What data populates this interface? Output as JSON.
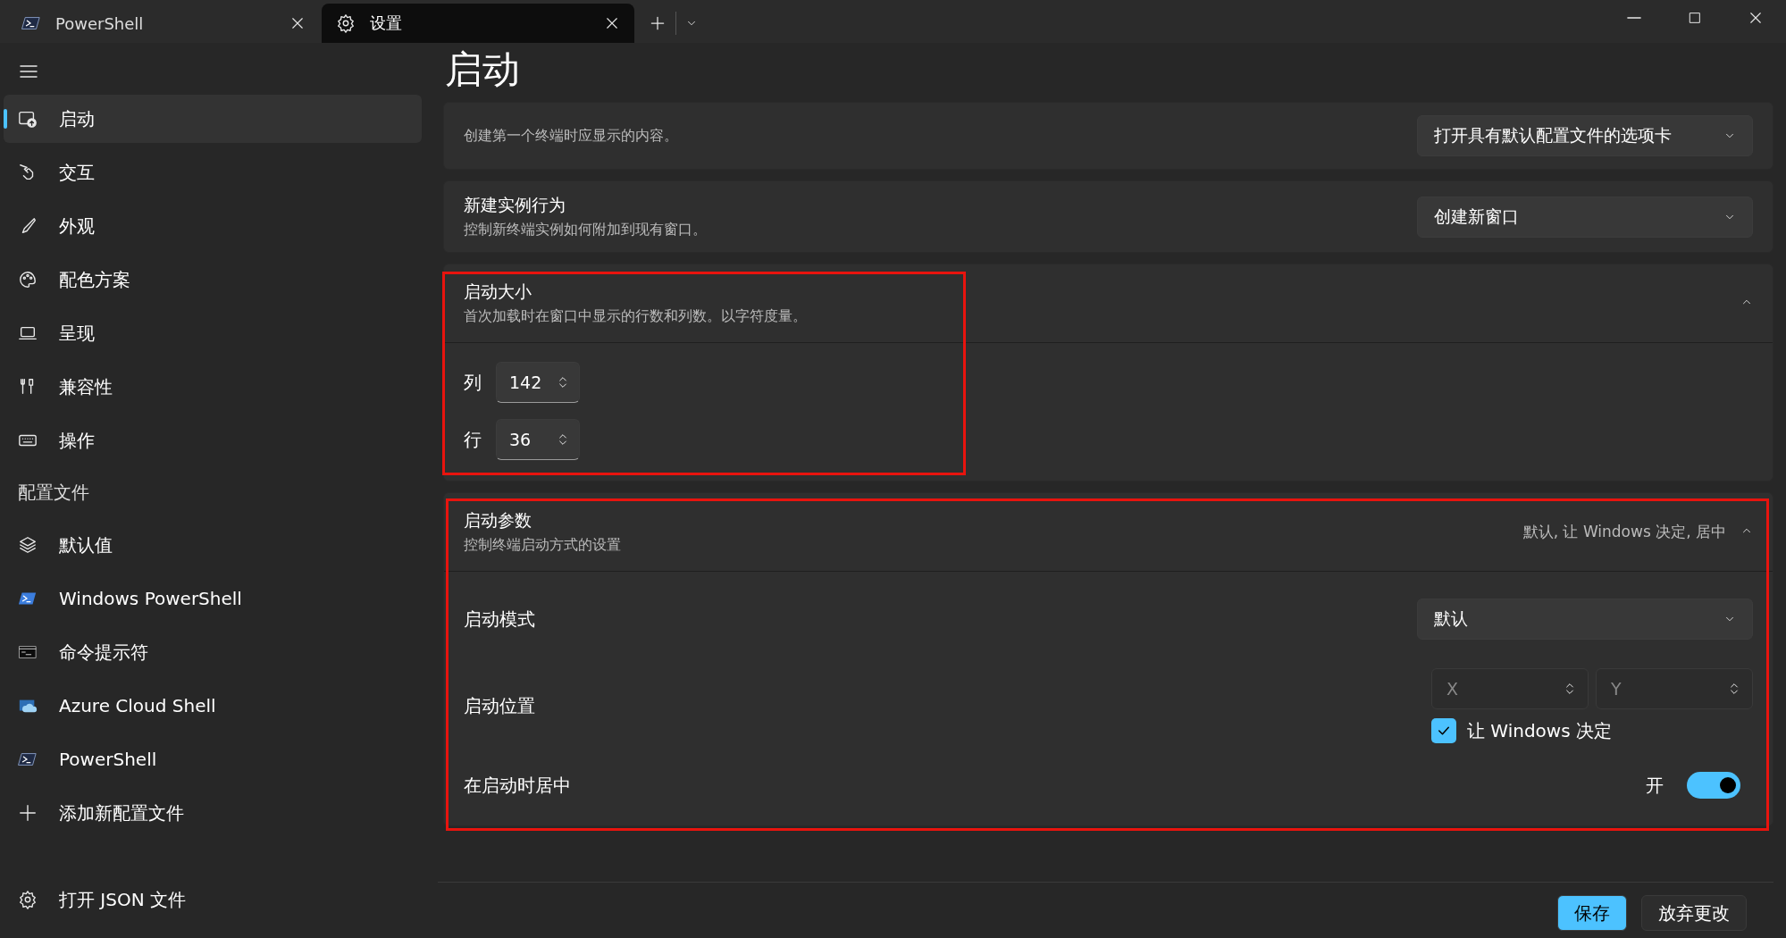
{
  "tabs": [
    {
      "label": "PowerShell",
      "selected": false
    },
    {
      "label": "设置",
      "selected": true
    }
  ],
  "sidebar": {
    "items": [
      {
        "kind": "nav",
        "label": "启动",
        "selected": true
      },
      {
        "kind": "nav",
        "label": "交互",
        "selected": false
      },
      {
        "kind": "nav",
        "label": "外观",
        "selected": false
      },
      {
        "kind": "nav",
        "label": "配色方案",
        "selected": false
      },
      {
        "kind": "nav",
        "label": "呈现",
        "selected": false
      },
      {
        "kind": "nav",
        "label": "兼容性",
        "selected": false
      },
      {
        "kind": "nav",
        "label": "操作",
        "selected": false
      },
      {
        "kind": "header",
        "label": "配置文件"
      },
      {
        "kind": "nav",
        "label": "默认值",
        "selected": false
      },
      {
        "kind": "nav",
        "label": "Windows PowerShell",
        "selected": false
      },
      {
        "kind": "nav",
        "label": "命令提示符",
        "selected": false
      },
      {
        "kind": "nav",
        "label": "Azure Cloud Shell",
        "selected": false
      },
      {
        "kind": "nav",
        "label": "PowerShell",
        "selected": false
      },
      {
        "kind": "nav",
        "label": "添加新配置文件",
        "selected": false
      }
    ],
    "footer_item": {
      "label": "打开 JSON 文件"
    }
  },
  "page": {
    "title": "启动",
    "cards": [
      {
        "kind": "dropdown",
        "description": "创建第一个终端时应显示的内容。",
        "value": "打开具有默认配置文件的选项卡"
      },
      {
        "kind": "dropdown",
        "title": "新建实例行为",
        "description": "控制新终端实例如何附加到现有窗口。",
        "value": "创建新窗口"
      },
      {
        "kind": "expander",
        "title": "启动大小",
        "description": "首次加载时在窗口中显示的行数和列数。以字符度量。",
        "expanded": true,
        "rows": [
          {
            "kind": "number",
            "label": "列",
            "value": "142"
          },
          {
            "kind": "number",
            "label": "行",
            "value": "36"
          }
        ]
      },
      {
        "kind": "expander",
        "title": "启动参数",
        "description": "控制终端启动方式的设置",
        "summary": "默认, 让 Windows 决定, 居中",
        "expanded": true,
        "rows": [
          {
            "kind": "dropdown",
            "label": "启动模式",
            "value": "默认"
          },
          {
            "kind": "position",
            "label": "启动位置",
            "x_placeholder": "X",
            "y_placeholder": "Y",
            "checkbox_label": "让 Windows 决定",
            "checked": true
          },
          {
            "kind": "toggle",
            "label": "在启动时居中",
            "state_text": "开",
            "on": true
          }
        ]
      }
    ]
  },
  "footer": {
    "buttons": [
      {
        "label": "保存",
        "kind": "primary"
      },
      {
        "label": "放弃更改",
        "kind": "secondary"
      }
    ]
  }
}
